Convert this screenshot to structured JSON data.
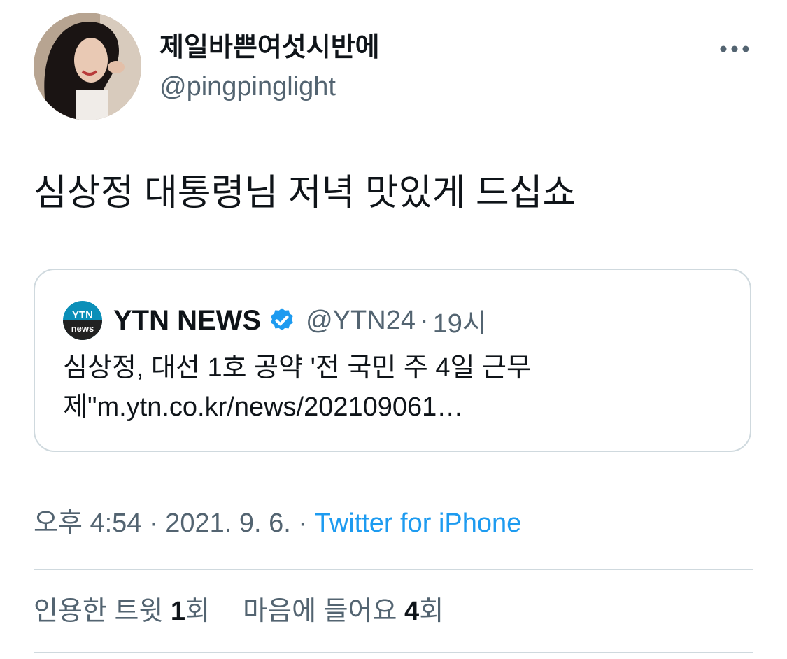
{
  "author": {
    "display_name": "제일바쁜여섯시반에",
    "handle": "@pingpinglight"
  },
  "more_icon": "more-horizontal-icon",
  "tweet": {
    "text": "심상정 대통령님 저녁 맛있게 드십쇼"
  },
  "quote": {
    "logo_top": "YTN",
    "logo_bottom": "news",
    "name": "YTN NEWS",
    "verified_icon": "verified-badge-icon",
    "handle": "@YTN24",
    "separator": "·",
    "time": "19시",
    "line1": "심상정, 대선 1호 공약 '전 국민 주 4일 근무",
    "line2": "제\"m.ytn.co.kr/news/202109061…"
  },
  "meta": {
    "time": "오후 4:54",
    "sep1": " · ",
    "date": "2021. 9. 6.",
    "sep2": " · ",
    "source": "Twitter for iPhone"
  },
  "stats": {
    "quote_label": "인용한 트윗 ",
    "quote_count": "1",
    "quote_unit": "회",
    "like_label": "마음에 들어요 ",
    "like_count": "4",
    "like_unit": "회"
  },
  "colors": {
    "text": "#0f1419",
    "secondary": "#536471",
    "accent": "#1d9bf0",
    "border": "#cfd9de"
  }
}
